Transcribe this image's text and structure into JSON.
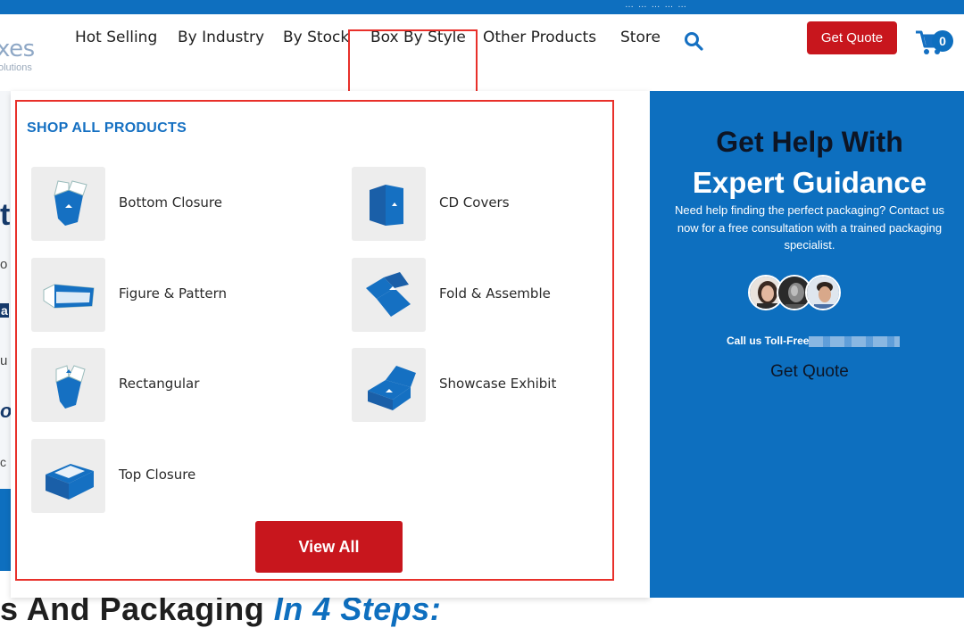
{
  "topbar": {
    "text": "… … … … …"
  },
  "header": {
    "logo_main": "xes",
    "logo_sub": "olutions",
    "nav": [
      "Hot Selling",
      "By Industry",
      "By Stock",
      "Box By Style",
      "Other Products",
      "Store"
    ],
    "quote_label": "Get Quote",
    "cart_count": "0"
  },
  "background": {
    "glyphs": [
      "t",
      "o",
      "a",
      "u",
      "o",
      "c"
    ],
    "heading_main": "s And Packaging ",
    "heading_em": "In 4 Steps:"
  },
  "dropdown": {
    "title": "SHOP ALL PRODUCTS",
    "products": [
      {
        "label": "Bottom Closure",
        "icon": "bottom-closure-box-icon"
      },
      {
        "label": "CD Covers",
        "icon": "cd-cover-icon"
      },
      {
        "label": "Figure & Pattern",
        "icon": "figure-pattern-box-icon"
      },
      {
        "label": "Fold & Assemble",
        "icon": "fold-assemble-box-icon"
      },
      {
        "label": "Rectangular",
        "icon": "rectangular-box-icon"
      },
      {
        "label": "Showcase Exhibit",
        "icon": "showcase-exhibit-box-icon"
      },
      {
        "label": "Top Closure",
        "icon": "top-closure-box-icon"
      }
    ],
    "view_all_label": "View All"
  },
  "help": {
    "title_line1": "Get Help With",
    "title_line2": "Expert Guidance",
    "text": "Need help finding the perfect packaging? Contact us now for a free consultation with a trained packaging specialist.",
    "call_label": "Call us Toll-Free",
    "quote_label": "Get Quote"
  },
  "colors": {
    "brand_blue": "#0e6fbf",
    "accent_red": "#c8161d",
    "highlight_red": "#e8302a"
  }
}
